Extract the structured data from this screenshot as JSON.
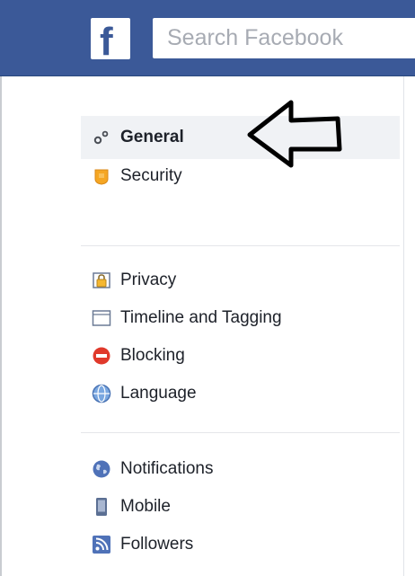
{
  "header": {
    "logo_letter": "f",
    "search_placeholder": "Search Facebook"
  },
  "sidebar": {
    "groups": [
      {
        "items": [
          {
            "label": "General",
            "icon": "gears-icon",
            "active": true
          },
          {
            "label": "Security",
            "icon": "shield-badge-icon",
            "active": false
          }
        ]
      },
      {
        "items": [
          {
            "label": "Privacy",
            "icon": "padlock-icon"
          },
          {
            "label": "Timeline and Tagging",
            "icon": "timeline-icon"
          },
          {
            "label": "Blocking",
            "icon": "blocking-icon"
          },
          {
            "label": "Language",
            "icon": "globe-icon"
          }
        ]
      },
      {
        "items": [
          {
            "label": "Notifications",
            "icon": "world-icon"
          },
          {
            "label": "Mobile",
            "icon": "mobile-icon"
          },
          {
            "label": "Followers",
            "icon": "rss-icon"
          }
        ]
      }
    ]
  },
  "colors": {
    "brand_blue": "#3b5998",
    "active_bg": "#f0f2f5",
    "security_yellow": "#f5a623",
    "blocking_red": "#e0392b"
  },
  "annotation": {
    "arrow": "left-pointing-outline-arrow"
  }
}
